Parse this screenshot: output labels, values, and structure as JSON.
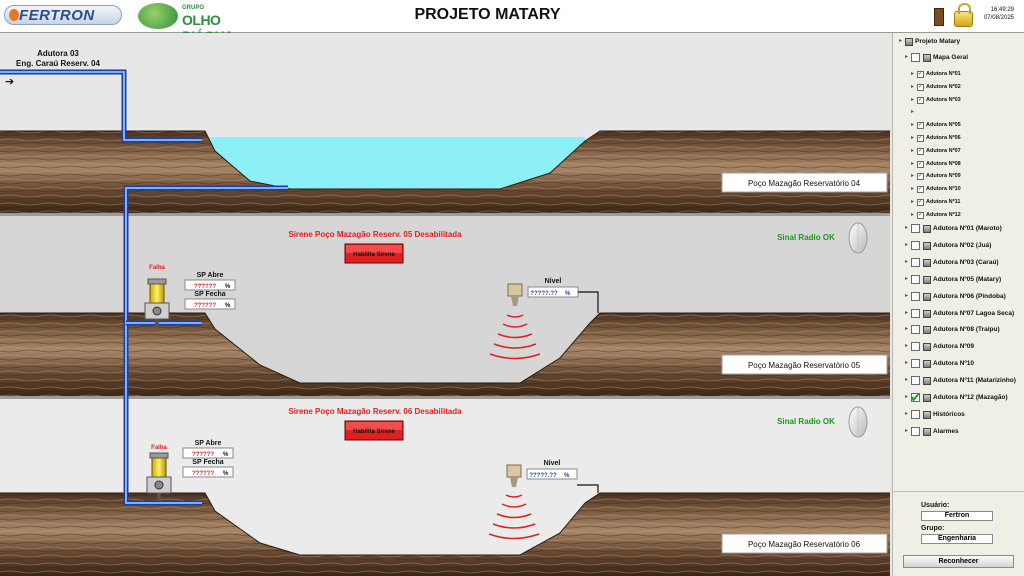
{
  "header": {
    "title": "PROJETO MATARY",
    "logo_left": "FERTRON",
    "logo_right_small": "GRUPO",
    "logo_right_big": "OLHO D'ÁGUA",
    "time": "16:49:29",
    "date": "07/08/2025"
  },
  "pipeline": {
    "adutora_label": "Adutora 03",
    "eng_label": "Eng. Caraú Reserv. 04",
    "arrow": "➔"
  },
  "reservoirs": [
    {
      "name": "Poço Mazagão Reservatório 04"
    },
    {
      "name": "Poço Mazagão Reservatório 05",
      "siren_status": "Sirene Poço Mazagão Reserv. 05 Desabilitada",
      "siren_button": "Habilita Sirene",
      "radio_status": "Sinal Radio OK",
      "pump_tag": "Falha",
      "sp_abre_label": "SP Abre",
      "sp_abre_value": "??????",
      "sp_fecha_label": "SP Fecha",
      "sp_fecha_value": "??????",
      "unit": "%",
      "nivel_label": "Nível",
      "nivel_value": "?????.??",
      "nivel_unit": "%"
    },
    {
      "name": "Poço Mazagão Reservatório 06",
      "siren_status": "Sirene Poço Mazagão Reserv. 06 Desabilitada",
      "siren_button": "Habilita Sirene",
      "radio_status": "Sinal Radio OK",
      "pump_tag": "Falha",
      "sp_abre_label": "SP Abre",
      "sp_abre_value": "??????",
      "sp_fecha_label": "SP Fecha",
      "sp_fecha_value": "??????",
      "unit": "%",
      "nivel_label": "Nível",
      "nivel_value": "?????.??",
      "nivel_unit": "%"
    }
  ],
  "sidebar": {
    "root": "Projeto Matary",
    "mapa": "Mapa Geral",
    "sub_items": [
      "Adutora Nº01",
      "Adutora Nº02",
      "Adutora Nº03",
      "",
      "Adutora Nº05",
      "Adutora Nº06",
      "Adutora Nº07",
      "Adutora Nº08",
      "Adutora Nº09",
      "Adutora Nº10",
      "Adutora Nº11",
      "Adutora Nº12"
    ],
    "main_items": [
      "Adutora Nº01 (Maroto)",
      "Adutora Nº02 (Juá)",
      "Adutora Nº03 (Caraú)",
      "Adutora Nº05 (Matary)",
      "Adutora Nº06 (Pindoba)",
      "Adutora Nº07 Lagoa Seca)",
      "Adutora Nº08 (Traipu)",
      "Adutora Nº09",
      "Adutora Nº10",
      "Adutora Nº11 (Matarizinho)",
      "Adutora Nº12 (Mazagão)",
      "Históricos",
      "Alarmes"
    ],
    "usuario_label": "Usuário:",
    "usuario_value": "Fertron",
    "grupo_label": "Grupo:",
    "grupo_value": "Engenharia",
    "reconnect_button": "Reconhecer"
  },
  "colors": {
    "water": "#8ef0f7",
    "pipe": "#3f6fd6",
    "alarm_red": "#e02020",
    "ok_green": "#1a9a1a"
  }
}
